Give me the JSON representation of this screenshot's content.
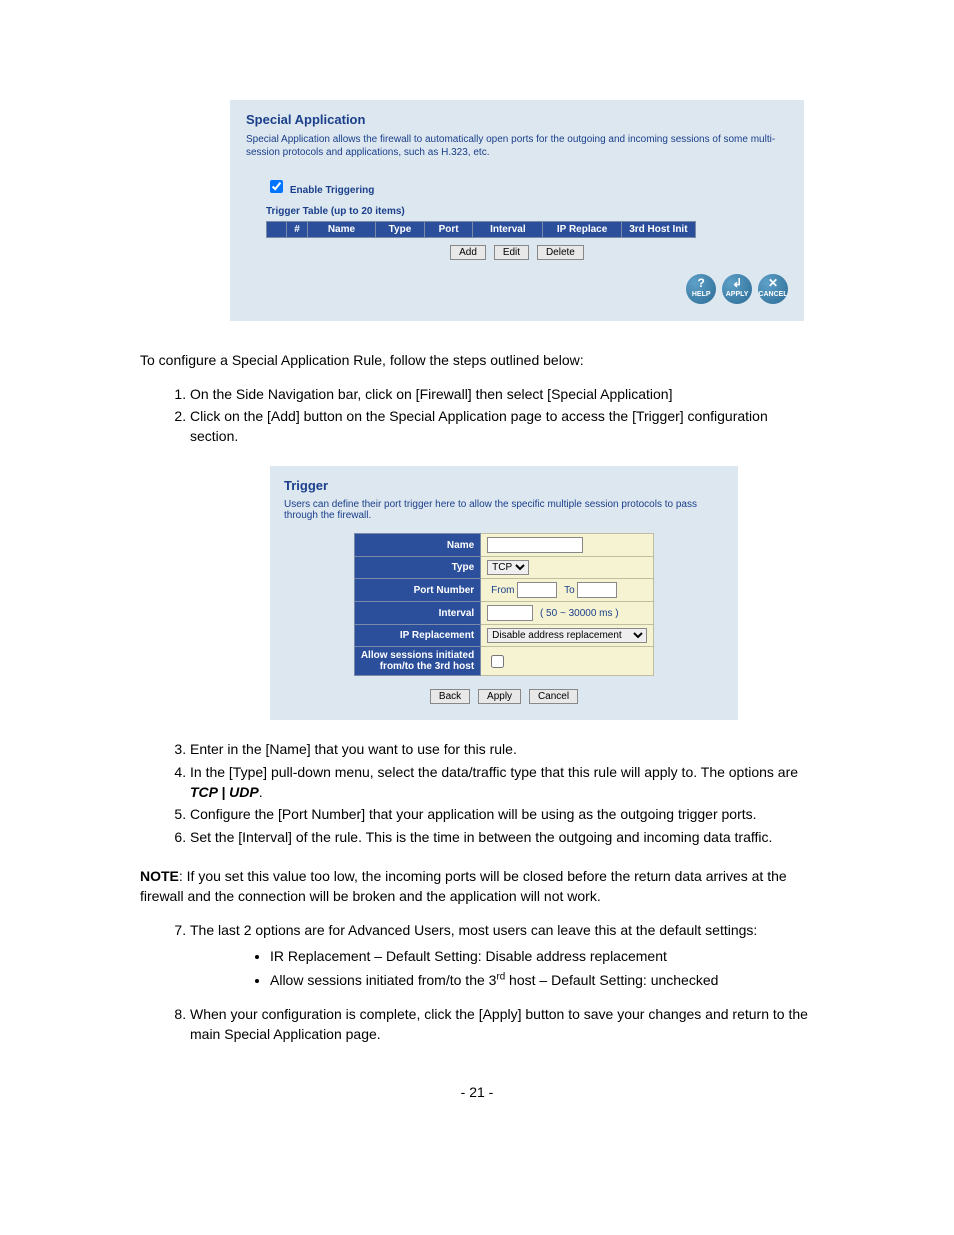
{
  "sa": {
    "title": "Special Application",
    "desc": "Special Application allows the firewall to automatically open ports for the outgoing and incoming sessions of some multi-session protocols and applications, such as H.323, etc.",
    "enable_label": "Enable Triggering",
    "table_caption": "Trigger Table (up to 20 items)",
    "cols": {
      "num": "#",
      "name": "Name",
      "type": "Type",
      "port": "Port",
      "interval": "Interval",
      "ipreplace": "IP Replace",
      "thirdhost": "3rd Host Init"
    },
    "btns": {
      "add": "Add",
      "edit": "Edit",
      "delete": "Delete"
    },
    "round": {
      "help": "HELP",
      "apply": "APPLY",
      "cancel": "CANCEL"
    }
  },
  "intro": "To configure a Special Application Rule, follow the steps outlined below:",
  "steps12": {
    "s1": "On the Side Navigation bar, click on [Firewall] then select [Special Application]",
    "s2": "Click on the [Add] button on the Special Application page to access the [Trigger] configuration section."
  },
  "trigger": {
    "title": "Trigger",
    "desc": "Users can define their port trigger here to allow the specific multiple session protocols to pass through the firewall.",
    "rows": {
      "name": "Name",
      "type": "Type",
      "port": "Port Number",
      "interval": "Interval",
      "ipr": "IP Replacement",
      "allow1": "Allow sessions initiated",
      "allow2": "from/to the 3rd host"
    },
    "type_value": "TCP",
    "port_from": "From",
    "port_to": "To",
    "interval_hint": "( 50 ~ 30000 ms )",
    "ipr_value": "Disable address replacement",
    "btns": {
      "back": "Back",
      "apply": "Apply",
      "cancel": "Cancel"
    }
  },
  "steps36": {
    "s3": "Enter in the [Name] that you want to use for this rule.",
    "s4a": "In the [Type] pull-down menu, select the data/traffic type that this rule will apply to. The options are ",
    "s4b": "TCP | UDP",
    "s4c": ".",
    "s5": "Configure the [Port Number] that your application will be using as the outgoing trigger ports.",
    "s6": "Set the [Interval] of the rule. This is the time in between the outgoing and incoming data traffic."
  },
  "note": {
    "label": "NOTE",
    "text": ":  If you set this value too low, the incoming ports will be closed before the return data arrives at the firewall and the connection will be broken and the application will not work."
  },
  "steps78": {
    "s7": "The last 2 options are for Advanced Users, most users can leave this at the default settings:",
    "b1": "IR Replacement – Default Setting: Disable address replacement",
    "b2a": "Allow sessions initiated from/to the 3",
    "b2sup": "rd",
    "b2b": " host – Default Setting: unchecked",
    "s8": "When your configuration is complete, click the [Apply] button to save your changes and return to the main Special Application page."
  },
  "page_number": "- 21 -"
}
